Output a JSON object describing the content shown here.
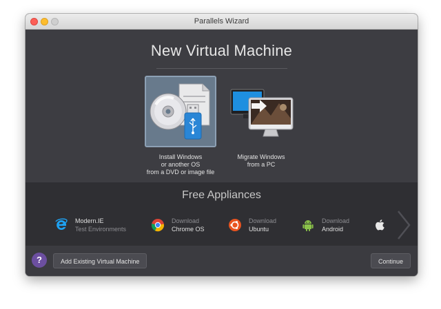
{
  "window": {
    "title": "Parallels Wizard"
  },
  "main": {
    "heading": "New Virtual Machine",
    "options": [
      {
        "label_lines": [
          "Install Windows",
          "or another OS",
          "from a DVD or image file"
        ],
        "selected": true,
        "icon": "dvd-usb-icon"
      },
      {
        "label_lines": [
          "Migrate Windows",
          "from a PC"
        ],
        "selected": false,
        "icon": "migrate-pc-icon"
      }
    ]
  },
  "appliances": {
    "title": "Free Appliances",
    "items": [
      {
        "line1": "Modern.IE",
        "line2": "Test Environments",
        "icon": "ie-icon"
      },
      {
        "line1": "Download",
        "line2": "Chrome OS",
        "icon": "chrome-icon"
      },
      {
        "line1": "Download",
        "line2": "Ubuntu",
        "icon": "ubuntu-icon"
      },
      {
        "line1": "Download",
        "line2": "Android",
        "icon": "android-icon"
      }
    ],
    "partial_icon": "apple-icon",
    "next_icon": "chevron-right-icon"
  },
  "footer": {
    "help_label": "?",
    "add_existing_label": "Add Existing Virtual Machine",
    "continue_label": "Continue"
  },
  "colors": {
    "window_bg": "#3b3b40",
    "appliances_bg": "#2f2f33",
    "selection": "#687a8c",
    "help_purple": "#6c4fa0"
  }
}
